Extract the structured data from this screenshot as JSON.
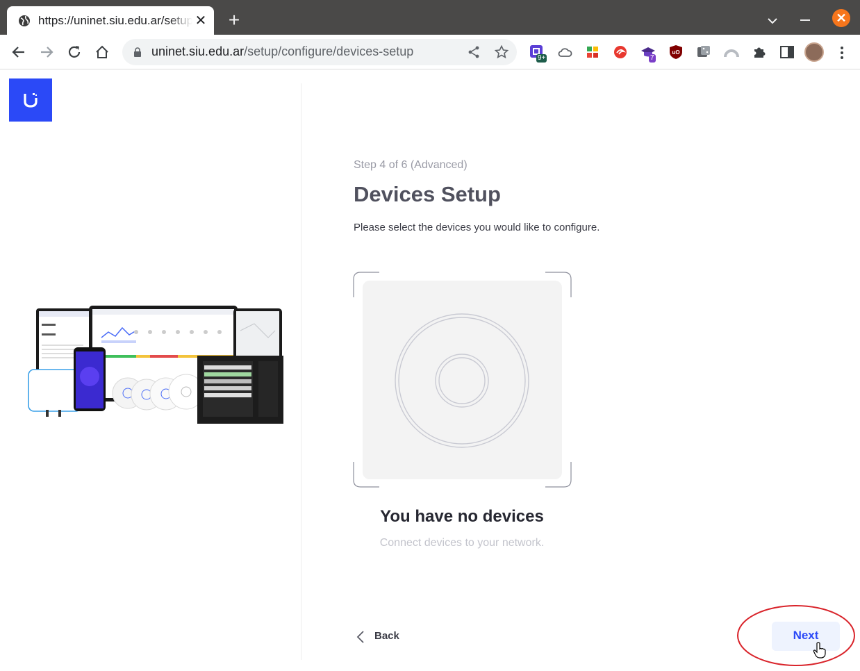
{
  "browser": {
    "tab_title": "https://uninet.siu.edu.ar/setup/configure/devices-setup",
    "close_tab_label": "✕",
    "new_tab_label": "+",
    "close_window_label": "✕",
    "url_domain": "uninet.siu.edu.ar",
    "url_path": "/setup/configure/devices-setup",
    "extensions": [
      {
        "icon": "notes-extension-icon",
        "badge": "9+"
      },
      {
        "icon": "cloud-extension-icon"
      },
      {
        "icon": "grid-extension-icon"
      },
      {
        "icon": "swirl-extension-icon"
      },
      {
        "icon": "puzzle-graduation-extension-icon",
        "badge": "7"
      },
      {
        "icon": "ublock-extension-icon"
      },
      {
        "icon": "dice-extension-icon"
      },
      {
        "icon": "arc-extension-icon"
      },
      {
        "icon": "puzzle-piece-icon"
      },
      {
        "icon": "side-panel-icon"
      }
    ]
  },
  "page": {
    "step": "Step 4 of 6 (Advanced)",
    "title": "Devices Setup",
    "description": "Please select the devices you would like to configure.",
    "empty_title": "You have no devices",
    "empty_subtitle": "Connect devices to your network.",
    "back_label": "Back",
    "next_label": "Next"
  },
  "colors": {
    "brand": "#2b49f7",
    "annotation_circle": "#d9232a"
  }
}
